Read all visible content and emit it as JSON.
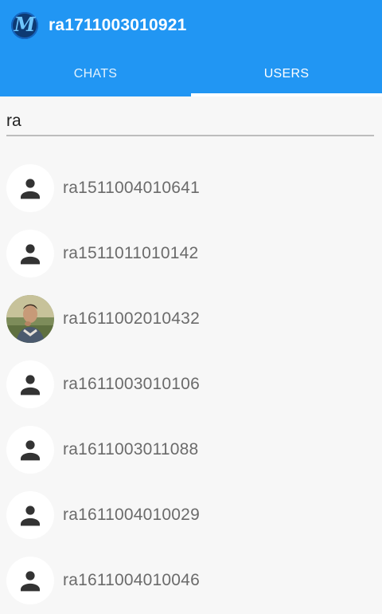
{
  "header": {
    "logo_letter": "M",
    "title": "ra1711003010921"
  },
  "tabs": [
    {
      "label": "CHATS",
      "active": false
    },
    {
      "label": "USERS",
      "active": true
    }
  ],
  "search": {
    "value": "ra"
  },
  "users": [
    {
      "name": "ra1511004010641",
      "avatar": "person-icon"
    },
    {
      "name": "ra1511011010142",
      "avatar": "person-icon"
    },
    {
      "name": "ra1611002010432",
      "avatar": "photo"
    },
    {
      "name": "ra1611003010106",
      "avatar": "person-icon"
    },
    {
      "name": "ra1611003011088",
      "avatar": "person-icon"
    },
    {
      "name": "ra1611004010029",
      "avatar": "person-icon"
    },
    {
      "name": "ra1611004010046",
      "avatar": "person-icon"
    }
  ],
  "colors": {
    "primary": "#2196f3",
    "logo_bg": "#0d3a73",
    "text_secondary": "#6b6b6b"
  }
}
